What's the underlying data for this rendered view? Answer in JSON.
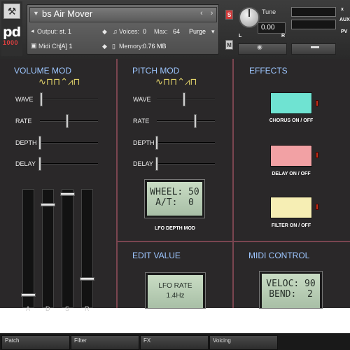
{
  "header": {
    "instrument_name": "bs Air Mover",
    "output_label": "Output:",
    "output_value": "st. 1",
    "voices_label": "Voices:",
    "voices_value": "0",
    "max_label": "Max:",
    "max_value": "64",
    "purge_label": "Purge",
    "midi_label": "Midi Ch:",
    "midi_value": "[A] 1",
    "memory_label": "Memory:",
    "memory_value": "0.76 MB",
    "solo_label": "S",
    "mute_label": "M",
    "tune_label": "Tune",
    "tune_value": "0.00",
    "logo_text": "pd",
    "logo_num": "1000",
    "right_labels": [
      "x",
      "AUX",
      "PV"
    ],
    "left_right": [
      "L",
      "R"
    ],
    "nav_arrows": "‹ ›",
    "camera_icon": "◉"
  },
  "volume_mod": {
    "title": "VOLUME MOD",
    "waves": "∿⊓⊓⌃⩘⊓",
    "labels": [
      "WAVE",
      "RATE",
      "DEPTH",
      "DELAY"
    ],
    "slider_positions": [
      0.02,
      0.45,
      0.0,
      0.0
    ],
    "fader_labels": [
      "A",
      "D",
      "S",
      "R"
    ],
    "fader_levels": [
      0.1,
      0.88,
      0.98,
      0.25
    ]
  },
  "pitch_mod": {
    "title": "PITCH MOD",
    "waves": "∿⊓⊓⌃⩘⊓",
    "labels": [
      "WAVE",
      "RATE",
      "DEPTH",
      "DELAY"
    ],
    "slider_positions": [
      0.42,
      0.62,
      0.0,
      0.0
    ],
    "lcd_line1": "WHEEL: 50",
    "lcd_line2": "A/T:  0",
    "lcd_caption": "LFO DEPTH MOD"
  },
  "effects": {
    "title": "EFFECTS",
    "chorus_label": "CHORUS ON / OFF",
    "delay_label": "DELAY ON / OFF",
    "filter_label": "FILTER ON / OFF",
    "colors": {
      "chorus": "#6fe3d2",
      "delay": "#f2a1a4",
      "filter": "#f6eeb4"
    }
  },
  "edit_value": {
    "title": "EDIT VALUE",
    "lcd_line1": "LFO RATE",
    "lcd_line2": "1.4Hz"
  },
  "midi_control": {
    "title": "MIDI CONTROL",
    "lcd_line1": "VELOC: 90",
    "lcd_line2": "BEND:  2"
  },
  "tabs": [
    "Patch",
    "Filter",
    "FX",
    "Voicing"
  ]
}
